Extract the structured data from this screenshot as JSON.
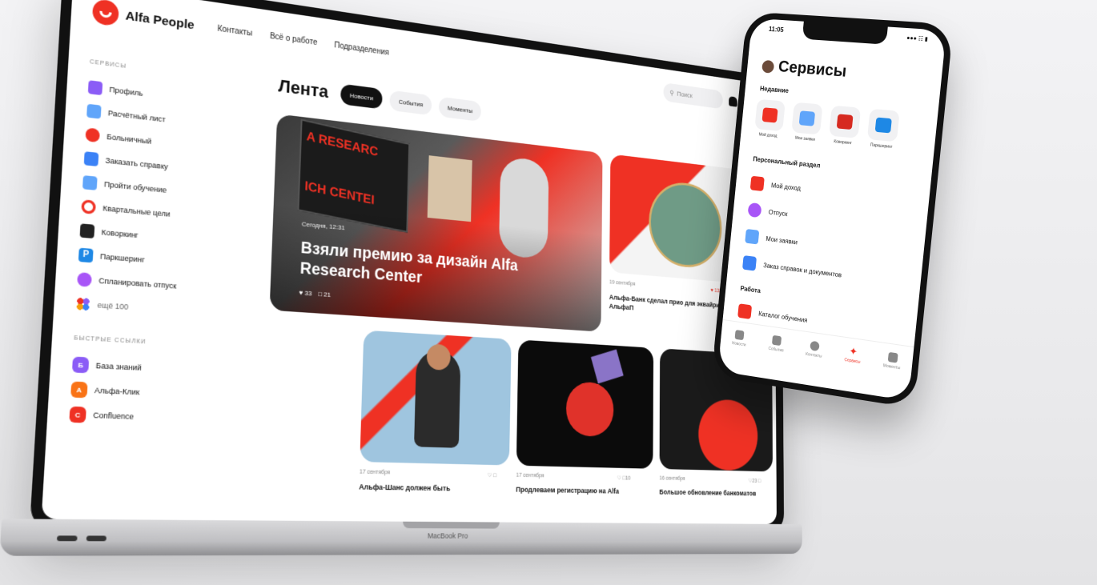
{
  "colors": {
    "accent": "#ef3124",
    "text": "#111111",
    "muted": "#888888"
  },
  "header": {
    "logo": "Alfa People",
    "nav": [
      "Контакты",
      "Всё о работе",
      "Подразделения"
    ],
    "search_placeholder": "Поиск"
  },
  "sidebar": {
    "services_title": "СЕРВИСЫ",
    "items": [
      {
        "label": "Профиль",
        "icon": "profile-icon",
        "color": "#8b5cf6"
      },
      {
        "label": "Расчётный лист",
        "icon": "payslip-icon",
        "color": "#60a5fa"
      },
      {
        "label": "Больничный",
        "icon": "heart-icon",
        "color": "#ef3124"
      },
      {
        "label": "Заказать справку",
        "icon": "document-icon",
        "color": "#3b82f6"
      },
      {
        "label": "Пройти обучение",
        "icon": "learning-icon",
        "color": "#60a5fa"
      },
      {
        "label": "Квартальные цели",
        "icon": "target-icon",
        "color": "#ef3124"
      },
      {
        "label": "Коворкинг",
        "icon": "chair-icon",
        "color": "#222222"
      },
      {
        "label": "Паркшеринг",
        "icon": "parking-icon",
        "color": "#1e88e5"
      },
      {
        "label": "Спланировать отпуск",
        "icon": "vacation-icon",
        "color": "#a855f7"
      },
      {
        "label": "ещё 100",
        "icon": "more-icon",
        "color": "#f59e0b"
      }
    ],
    "quick_links_title": "БЫСТРЫЕ ССЫЛКИ",
    "quick_links": [
      {
        "letter": "Б",
        "label": "База знаний",
        "color": "#8b5cf6"
      },
      {
        "letter": "А",
        "label": "Альфа-Клик",
        "color": "#f97316"
      },
      {
        "letter": "C",
        "label": "Confluence",
        "color": "#ef3124"
      }
    ]
  },
  "feed": {
    "title": "Лента",
    "tabs": [
      "Новости",
      "События",
      "Моменты"
    ],
    "hero": {
      "date": "Сегодня, 12:31",
      "title": "Взяли премию за дизайн Alfa Research Center",
      "likes": "33",
      "comments": "21"
    },
    "side": {
      "date": "19 сентября",
      "likes": "133",
      "title": "Альфа-Банк сделал прио для эквайринга АльфаП"
    },
    "cards": [
      {
        "date": "17 сентября",
        "title": "Альфа-Шанс должен быть"
      },
      {
        "date": "17 сентября",
        "comments": "10",
        "title": "Продлеваем регистрацию на Alfa"
      },
      {
        "date": "16 сентября",
        "likes": "23",
        "title": "Большое обновление банкоматов"
      }
    ]
  },
  "laptop_label": "MacBook Pro",
  "phone": {
    "time": "11:05",
    "title": "Сервисы",
    "recent_title": "Недавние",
    "recent": [
      {
        "label": "Мой доход",
        "color": "#ef3124"
      },
      {
        "label": "Мои заявки",
        "color": "#60a5fa"
      },
      {
        "label": "Коворкинг",
        "color": "#d62a20"
      },
      {
        "label": "Паркшеринг",
        "color": "#1e88e5"
      }
    ],
    "personal_title": "Персональный раздел",
    "personal": [
      {
        "label": "Мой доход",
        "color": "#ef3124"
      },
      {
        "label": "Отпуск",
        "color": "#a855f7"
      },
      {
        "label": "Мои заявки",
        "color": "#60a5fa"
      },
      {
        "label": "Заказ справок и документов",
        "color": "#3b82f6"
      }
    ],
    "work_title": "Работа",
    "work": [
      {
        "label": "Каталог обучения",
        "color": "#ef3124"
      }
    ],
    "tabbar": [
      "Новости",
      "События",
      "Контакты",
      "Сервисы",
      "Моменты"
    ]
  }
}
